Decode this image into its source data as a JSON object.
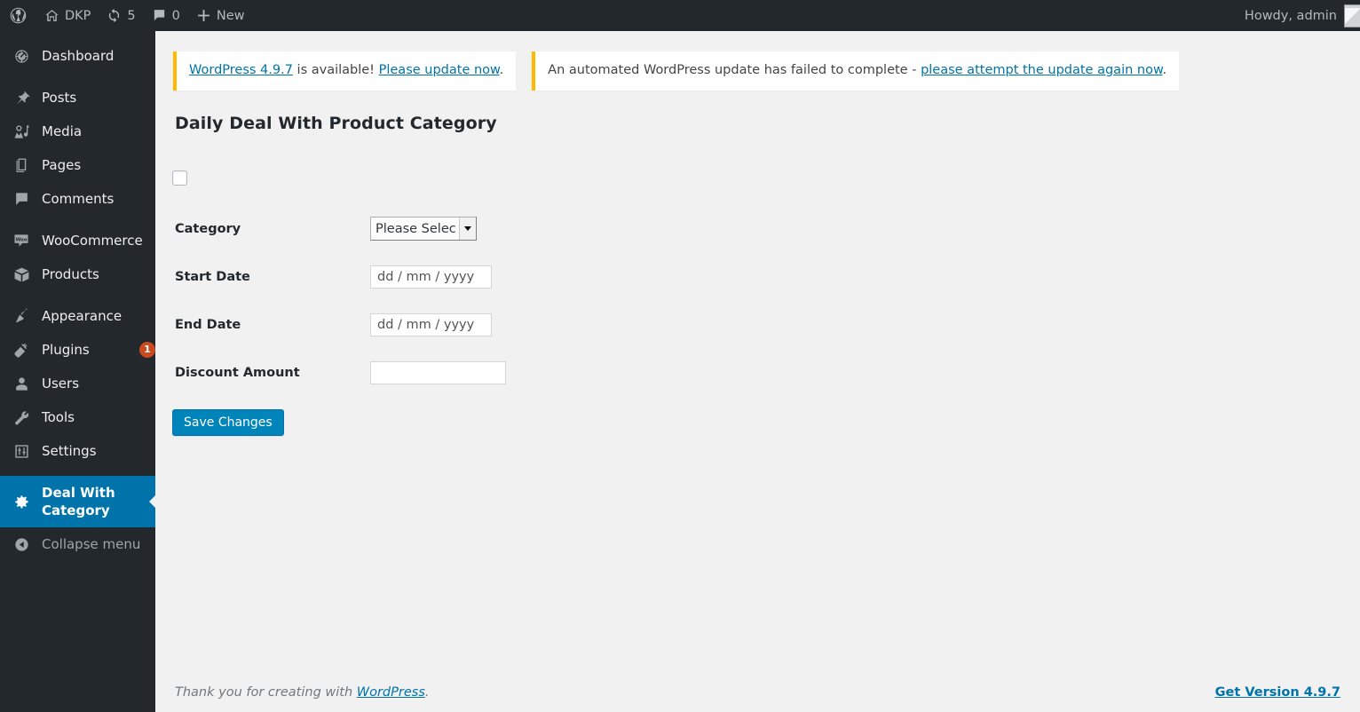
{
  "adminbar": {
    "wp_logo_icon": "wordpress-logo-icon",
    "site": {
      "label": "DKP",
      "icon": "home-icon"
    },
    "updates": {
      "count": "5",
      "icon": "updates-icon"
    },
    "comments": {
      "count": "0",
      "icon": "comment-bubble-icon"
    },
    "new": {
      "label": "New",
      "icon": "plus-icon"
    },
    "howdy": "Howdy, admin",
    "avatar_icon": "user-avatar"
  },
  "sidebar": {
    "items": [
      {
        "label": "Dashboard",
        "icon": "dashboard-icon",
        "name": "dashboard"
      },
      {
        "label": "Posts",
        "icon": "pin-icon",
        "name": "posts"
      },
      {
        "label": "Media",
        "icon": "media-icon",
        "name": "media"
      },
      {
        "label": "Pages",
        "icon": "pages-icon",
        "name": "pages"
      },
      {
        "label": "Comments",
        "icon": "comment-bubble-icon",
        "name": "comments"
      },
      {
        "label": "WooCommerce",
        "icon": "woocommerce-icon",
        "name": "woocommerce"
      },
      {
        "label": "Products",
        "icon": "products-box-icon",
        "name": "products"
      },
      {
        "label": "Appearance",
        "icon": "paintbrush-icon",
        "name": "appearance"
      },
      {
        "label": "Plugins",
        "icon": "plug-icon",
        "name": "plugins",
        "badge": "1"
      },
      {
        "label": "Users",
        "icon": "user-icon",
        "name": "users"
      },
      {
        "label": "Tools",
        "icon": "wrench-icon",
        "name": "tools"
      },
      {
        "label": "Settings",
        "icon": "settings-sliders-icon",
        "name": "settings"
      },
      {
        "label": "Deal With Category",
        "icon": "gear-icon",
        "name": "deal-with-category",
        "active": true
      }
    ],
    "collapse": {
      "label": "Collapse menu",
      "icon": "collapse-arrow-icon"
    }
  },
  "notices": {
    "update_available": {
      "link_version": "WordPress 4.9.7",
      "middle": " is available! ",
      "link_action": "Please update now",
      "end": "."
    },
    "update_failed": {
      "text": "An automated WordPress update has failed to complete - ",
      "link": "please attempt the update again now",
      "end": "."
    }
  },
  "page": {
    "title": "Daily Deal With Product Category"
  },
  "form": {
    "enable_toggle_name": "enable-deal-checkbox",
    "category": {
      "label": "Category",
      "selected": "Please Select",
      "options": [
        "Please Select"
      ]
    },
    "start_date": {
      "label": "Start Date",
      "placeholder": "dd / mm / yyyy",
      "value": ""
    },
    "end_date": {
      "label": "End Date",
      "placeholder": "dd / mm / yyyy",
      "value": ""
    },
    "discount_amount": {
      "label": "Discount Amount",
      "placeholder": "",
      "value": ""
    },
    "save_label": "Save Changes"
  },
  "footer": {
    "thanks_prefix": "Thank you for creating with ",
    "wordpress_link": "WordPress",
    "thanks_suffix": ".",
    "version_link": "Get Version 4.9.7"
  },
  "colors": {
    "sidebar_bg": "#23282d",
    "active_blue": "#0073aa",
    "button_blue": "#0085ba",
    "link_blue": "#0073aa",
    "notice_border": "#ffb900",
    "badge_red": "#ca4a1f",
    "content_bg": "#f1f1f1"
  }
}
